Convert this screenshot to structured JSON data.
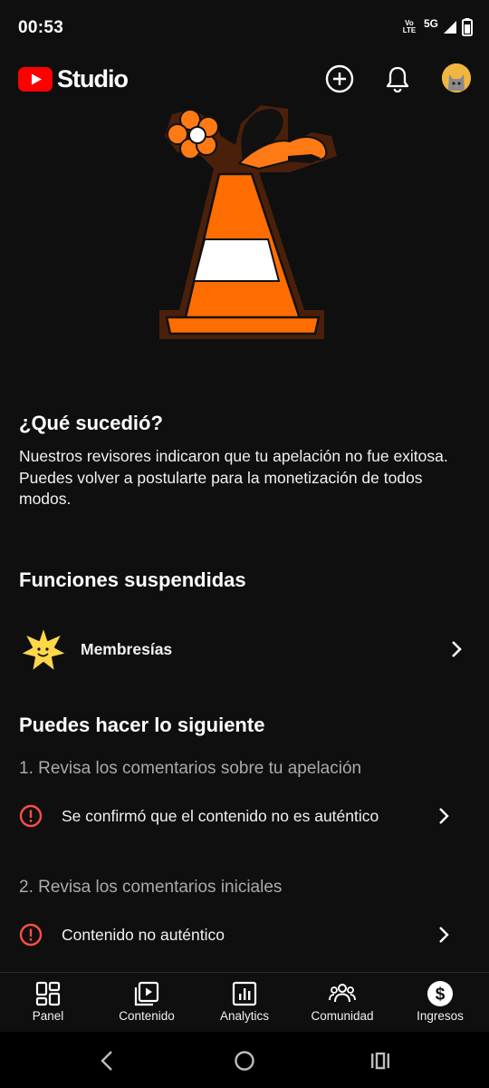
{
  "status_bar": {
    "time": "00:53",
    "volte": "Vo LTE",
    "network": "5G"
  },
  "header": {
    "logo_text": "Studio",
    "brand_color": "#ff0000",
    "icons": [
      "create-icon",
      "notifications-icon",
      "avatar"
    ]
  },
  "what_happened": {
    "title": "¿Qué sucedió?",
    "body": "Nuestros revisores indicaron que tu apelación no fue exitosa. Puedes volver a postularte para la monetización de todos modos."
  },
  "suspended": {
    "title": "Funciones suspendidas",
    "items": [
      {
        "label": "Membresías",
        "icon": "membership-star-icon"
      }
    ]
  },
  "next_steps": {
    "title": "Puedes hacer lo siguiente",
    "steps": [
      {
        "heading": "1. Revisa los comentarios sobre tu apelación",
        "item": "Se confirmó que el contenido no es auténtico"
      },
      {
        "heading": "2. Revisa los comentarios iniciales",
        "item": "Contenido no auténtico"
      }
    ],
    "alert_color": "#ff4e45"
  },
  "bottom_nav": {
    "items": [
      {
        "label": "Panel",
        "icon": "dashboard-icon"
      },
      {
        "label": "Contenido",
        "icon": "content-icon"
      },
      {
        "label": "Analytics",
        "icon": "analytics-icon"
      },
      {
        "label": "Comunidad",
        "icon": "community-icon"
      },
      {
        "label": "Ingresos",
        "icon": "earn-icon",
        "selected": true
      }
    ]
  },
  "system_nav": {
    "icons": [
      "back-icon",
      "home-icon",
      "recents-icon"
    ]
  }
}
